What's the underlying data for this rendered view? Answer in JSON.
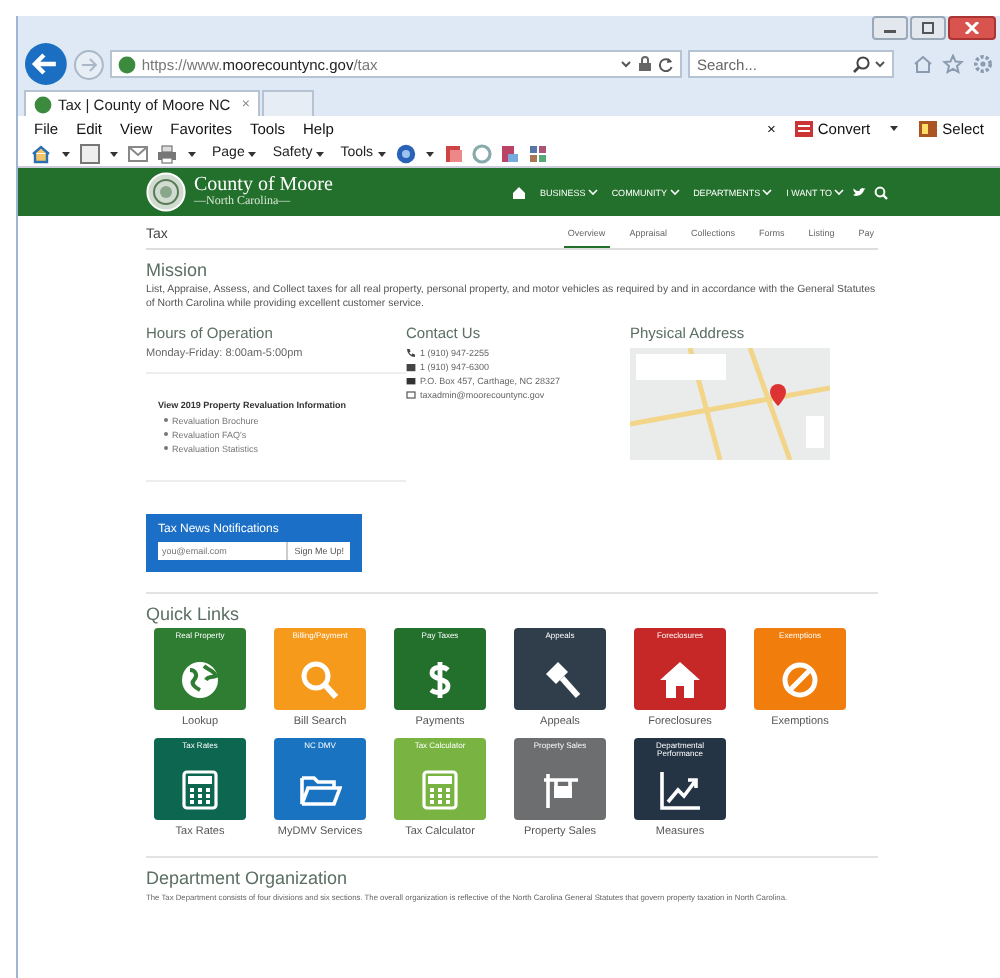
{
  "browser": {
    "url": "https://www.**moorecountync.gov**/tax",
    "search": {
      "placeholder": "Search..."
    },
    "tabs": [
      {
        "label": "Tax | County of Moore NC",
        "close": "×",
        "selected": true
      }
    ],
    "menu": [
      "File",
      "Edit",
      "View",
      "Favorites",
      "Tools",
      "Help"
    ],
    "toolbar_right": {
      "close": "×",
      "convert": "Convert",
      "select": "Select"
    },
    "commands": [
      "Page",
      "Safety",
      "Tools"
    ]
  },
  "site": {
    "logo_title": "County of Moore",
    "logo_subtitle": "—North Carolina—",
    "nav": [
      "BUSINESS",
      "COMMUNITY",
      "DEPARTMENTS",
      "I WANT TO"
    ]
  },
  "page": {
    "title": "Tax",
    "subnav": [
      {
        "label": "Overview",
        "selected": true
      },
      {
        "label": "Appraisal",
        "selected": false
      },
      {
        "label": "Collections",
        "selected": false
      },
      {
        "label": "Forms",
        "selected": false
      },
      {
        "label": "Listing",
        "selected": false
      },
      {
        "label": "Pay",
        "selected": false
      }
    ],
    "mission": {
      "heading": "Mission",
      "text": "List, Appraise, Assess, and Collect taxes for all real property, personal property, and motor vehicles as required by and in accordance with the General Statutes of North Carolina while providing excellent customer service."
    },
    "hours": {
      "heading": "Hours of Operation",
      "text": "Monday-Friday: 8:00am-5:00pm"
    },
    "contact": {
      "heading": "Contact Us",
      "items": [
        {
          "kind": "phone",
          "text": "1 (910) 947-2255"
        },
        {
          "kind": "fax",
          "text": "1 (910) 947-6300"
        },
        {
          "kind": "mail",
          "text": "P.O. Box 457, Carthage, NC 28327"
        },
        {
          "kind": "email",
          "text": "taxadmin@moorecountync.gov"
        }
      ]
    },
    "address": {
      "heading": "Physical Address"
    },
    "revaluation": {
      "heading": "View 2019 Property Revaluation Information",
      "links": [
        "Revaluation Brochure",
        "Revaluation FAQ's",
        "Revaluation Statistics"
      ]
    },
    "notifications": {
      "title": "Tax News Notifications",
      "placeholder": "you@email.com",
      "button": "Sign Me Up!"
    },
    "quick_links": {
      "heading": "Quick Links",
      "tiles": [
        {
          "title": "Real Property",
          "label": "Lookup",
          "color": "#2e7d32",
          "kind": "globe"
        },
        {
          "title": "Billing/Payment",
          "label": "Bill Search",
          "color": "#f59a1b",
          "kind": "search"
        },
        {
          "title": "Pay Taxes",
          "label": "Payments",
          "color": "#23702c",
          "kind": "dollar"
        },
        {
          "title": "Appeals",
          "label": "Appeals",
          "color": "#2f3e4a",
          "kind": "gavel"
        },
        {
          "title": "Foreclosures",
          "label": "Foreclosures",
          "color": "#c62828",
          "kind": "house"
        },
        {
          "title": "Exemptions",
          "label": "Exemptions",
          "color": "#f07d0c",
          "kind": "ban"
        },
        {
          "title": "Tax Rates",
          "label": "Tax Rates",
          "color": "#0d6650",
          "kind": "calculator"
        },
        {
          "title": "NC DMV",
          "label": "MyDMV Services",
          "color": "#1a73c0",
          "kind": "folder"
        },
        {
          "title": "Tax Calculator",
          "label": "Tax Calculator",
          "color": "#79b443",
          "kind": "calculator"
        },
        {
          "title": "Property Sales",
          "label": "Property Sales",
          "color": "#6d6e70",
          "kind": "sign"
        },
        {
          "title": "Departmental Performance",
          "label": "Measures",
          "color": "#253445",
          "kind": "chart"
        }
      ]
    },
    "organization": {
      "heading": "Department Organization",
      "text": "The Tax Department consists of four divisions and six sections. The overall organization is reflective of the North Carolina General Statutes that govern property taxation in North Carolina."
    }
  }
}
